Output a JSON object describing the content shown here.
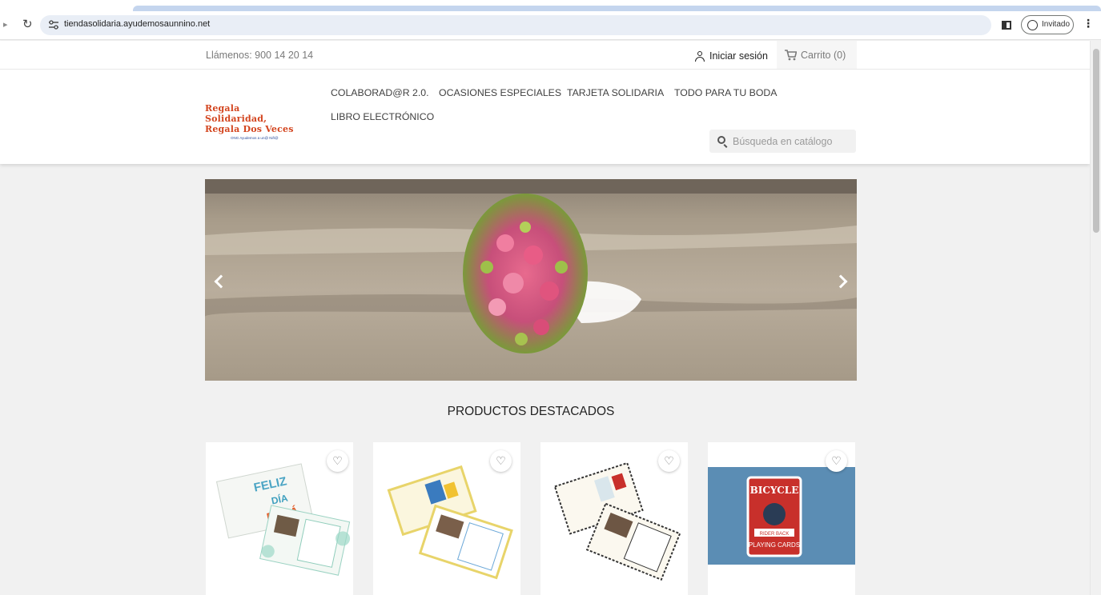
{
  "browser": {
    "url": "tiendasolidaria.ayudemosaunnino.net",
    "profile_label": "Invitado"
  },
  "header": {
    "contact": "Llámenos: 900 14 20 14",
    "signin_label": "Iniciar sesión",
    "cart_label": "Carrito (0)",
    "search_placeholder": "Búsqueda en catálogo"
  },
  "logo": {
    "line1": "Regala Solidaridad,",
    "line2": "Regala Dos Veces",
    "subtitle": "ONG Ayudemos a un@ Niñ@"
  },
  "nav": {
    "items": [
      {
        "label": "COLABORAD@R 2.0."
      },
      {
        "label": "OCASIONES ESPECIALES"
      },
      {
        "label": "TARJETA SOLIDARIA"
      },
      {
        "label": "TODO PARA TU BODA"
      },
      {
        "label": "LIBRO ELECTRÓNICO"
      }
    ]
  },
  "section": {
    "title": "PRODUCTOS DESTACADOS"
  },
  "products": [
    {
      "image_text": "FELIZ DÍA PAPÁ",
      "icon": "heart-outline-icon"
    },
    {
      "image_text": "",
      "icon": "heart-outline-icon"
    },
    {
      "image_text": "",
      "icon": "heart-outline-icon"
    },
    {
      "image_text": "BICYCLE RIDER BACK PLAYING CARDS",
      "icon": "heart-outline-icon"
    }
  ],
  "colors": {
    "page_bg": "#f1f1f1",
    "logo_red": "#d3451f",
    "logo_blue": "#2a4d9c",
    "omnibox_bg": "#e9eef6",
    "cards_red": "#c8302b",
    "cards_bg": "#5b8db4"
  }
}
